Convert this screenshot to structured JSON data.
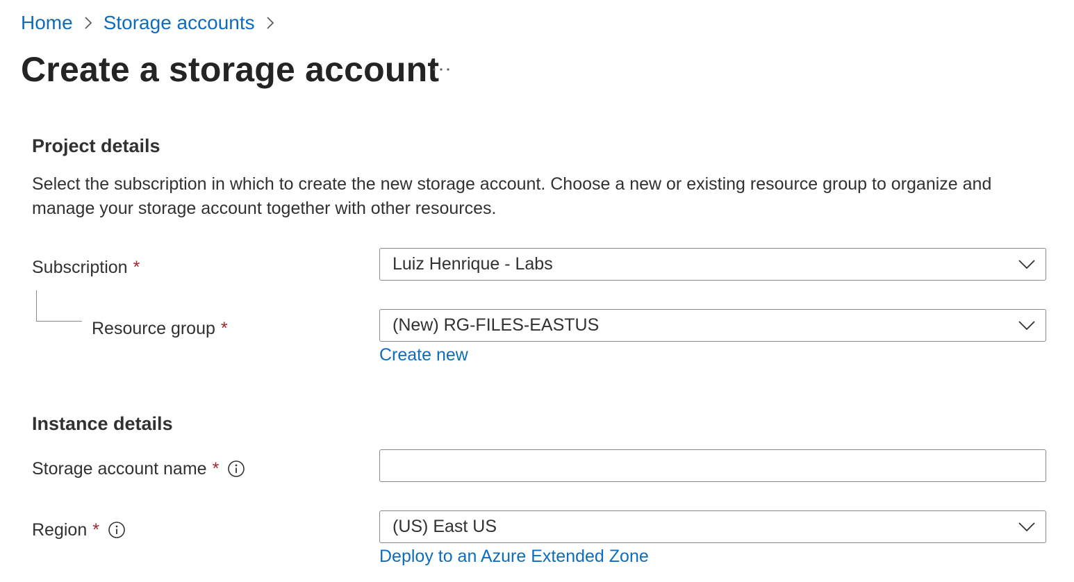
{
  "breadcrumb": {
    "items": [
      "Home",
      "Storage accounts"
    ]
  },
  "page": {
    "title": "Create a storage account",
    "more_label": "···"
  },
  "project_details": {
    "title": "Project details",
    "description": "Select the subscription in which to create the new storage account. Choose a new or existing resource group to organize and manage your storage account together with other resources.",
    "subscription": {
      "label": "Subscription",
      "required_mark": "*",
      "value": "Luiz Henrique - Labs"
    },
    "resource_group": {
      "label": "Resource group",
      "required_mark": "*",
      "value": "(New) RG-FILES-EASTUS",
      "create_new_label": "Create new"
    }
  },
  "instance_details": {
    "title": "Instance details",
    "storage_account_name": {
      "label": "Storage account name",
      "required_mark": "*",
      "value": "",
      "placeholder": ""
    },
    "region": {
      "label": "Region",
      "required_mark": "*",
      "value": "(US) East US",
      "extended_zone_link": "Deploy to an Azure Extended Zone"
    }
  },
  "colors": {
    "link": "#0f6cbd",
    "required": "#a4262c",
    "text": "#323130",
    "border": "#8a8886"
  },
  "icons": [
    "chevron-right-icon",
    "more-icon",
    "chevron-down-icon",
    "info-icon"
  ]
}
